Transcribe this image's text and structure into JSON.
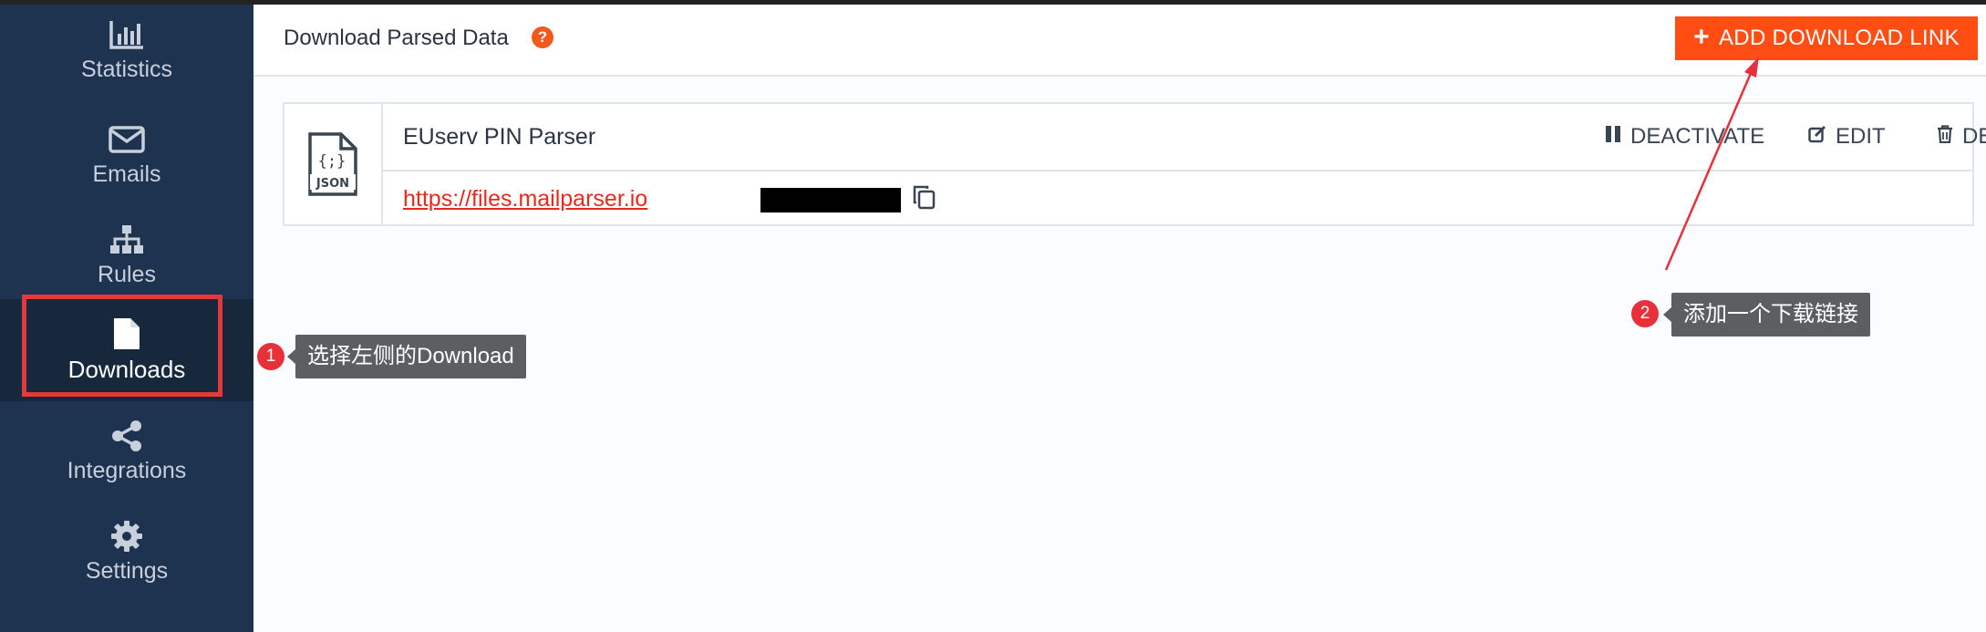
{
  "sidebar": {
    "items": [
      {
        "label": "Statistics",
        "icon": "bar-chart-icon"
      },
      {
        "label": "Emails",
        "icon": "envelope-icon"
      },
      {
        "label": "Rules",
        "icon": "sitemap-icon"
      },
      {
        "label": "Downloads",
        "icon": "file-icon",
        "active": true
      },
      {
        "label": "Integrations",
        "icon": "share-icon"
      },
      {
        "label": "Settings",
        "icon": "gear-icon"
      }
    ]
  },
  "header": {
    "title": "Download Parsed Data",
    "help_icon": "?",
    "add_button_label": "ADD DOWNLOAD LINK"
  },
  "download": {
    "type_label": "JSON",
    "parser_name": "EUserv PIN Parser",
    "url": "https://files.mailparser.io",
    "actions": {
      "deactivate": "DEACTIVATE",
      "edit": "EDIT",
      "delete": "DELETE"
    }
  },
  "annotations": [
    {
      "number": "1",
      "text": "选择左侧的Download"
    },
    {
      "number": "2",
      "text": "添加一个下载链接"
    }
  ],
  "colors": {
    "sidebar_bg": "#1e3350",
    "accent": "#ff4d13",
    "link": "#e8291c",
    "annotation_red": "#e5383b"
  }
}
